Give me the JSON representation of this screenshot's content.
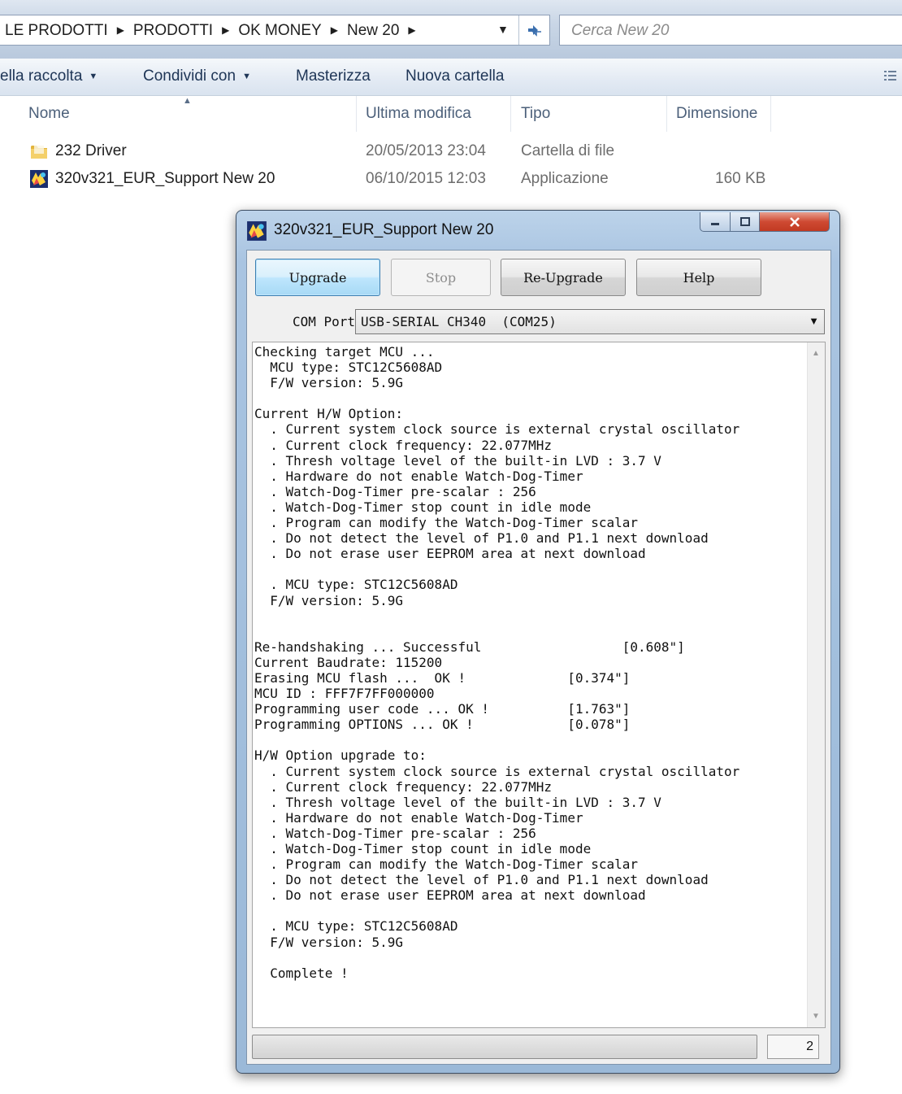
{
  "explorer": {
    "breadcrumbs": [
      "LE PRODOTTI",
      "PRODOTTI",
      "OK MONEY",
      "New 20"
    ],
    "search_placeholder": "Cerca New 20",
    "toolbar": {
      "include_in_library": "ella raccolta",
      "share_with": "Condividi con",
      "burn": "Masterizza",
      "new_folder": "Nuova cartella"
    },
    "columns": {
      "name": "Nome",
      "modified": "Ultima modifica",
      "type": "Tipo",
      "size": "Dimensione"
    },
    "files": [
      {
        "name": "232 Driver",
        "modified": "20/05/2013 23:04",
        "type": "Cartella di file",
        "size": "",
        "icon": "folder-icon"
      },
      {
        "name": "320v321_EUR_Support New 20",
        "modified": "06/10/2015 12:03",
        "type": "Applicazione",
        "size": "160 KB",
        "icon": "app-icon"
      }
    ]
  },
  "dialog": {
    "title": "320v321_EUR_Support New 20",
    "buttons": {
      "upgrade": "Upgrade",
      "stop": "Stop",
      "reupgrade": "Re-Upgrade",
      "help": "Help"
    },
    "com_port_label": "COM Port",
    "com_port_value": "USB-SERIAL CH340  (COM25)",
    "log": "Checking target MCU ...\n  MCU type: STC12C5608AD\n  F/W version: 5.9G\n\nCurrent H/W Option:\n  . Current system clock source is external crystal oscillator\n  . Current clock frequency: 22.077MHz\n  . Thresh voltage level of the built-in LVD : 3.7 V\n  . Hardware do not enable Watch-Dog-Timer\n  . Watch-Dog-Timer pre-scalar : 256\n  . Watch-Dog-Timer stop count in idle mode\n  . Program can modify the Watch-Dog-Timer scalar\n  . Do not detect the level of P1.0 and P1.1 next download\n  . Do not erase user EEPROM area at next download\n\n  . MCU type: STC12C5608AD\n  F/W version: 5.9G\n\n\nRe-handshaking ... Successful                  [0.608\"]\nCurrent Baudrate: 115200\nErasing MCU flash ...  OK !             [0.374\"]\nMCU ID : FFF7F7FF000000\nProgramming user code ... OK !          [1.763\"]\nProgramming OPTIONS ... OK !            [0.078\"]\n\nH/W Option upgrade to:\n  . Current system clock source is external crystal oscillator\n  . Current clock frequency: 22.077MHz\n  . Thresh voltage level of the built-in LVD : 3.7 V\n  . Hardware do not enable Watch-Dog-Timer\n  . Watch-Dog-Timer pre-scalar : 256\n  . Watch-Dog-Timer stop count in idle mode\n  . Program can modify the Watch-Dog-Timer scalar\n  . Do not detect the level of P1.0 and P1.1 next download\n  . Do not erase user EEPROM area at next download\n\n  . MCU type: STC12C5608AD\n  F/W version: 5.9G\n\n  Complete !",
    "progress_fraction": 0,
    "counter": "2"
  }
}
